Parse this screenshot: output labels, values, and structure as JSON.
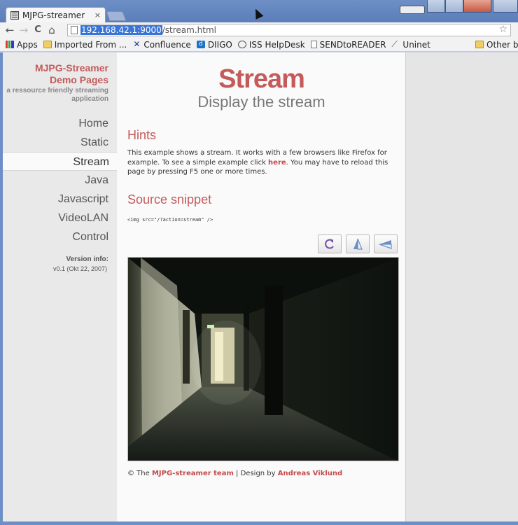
{
  "browser": {
    "tab_title": "MJPG-streamer",
    "tab_close": "×",
    "url_host": "192.168.42.1:9000",
    "url_path": "/stream.html",
    "nav": {
      "back": "←",
      "forward": "→",
      "reload": "C",
      "home": "⌂",
      "star": "☆"
    },
    "bookmarks": [
      {
        "label": "Apps",
        "icon": "apps-icon"
      },
      {
        "label": "Imported From ...",
        "icon": "folder-icon"
      },
      {
        "label": "Confluence",
        "icon": "confluence-icon"
      },
      {
        "label": "DIIGO",
        "icon": "diigo-icon"
      },
      {
        "label": "ISS HelpDesk",
        "icon": "iss-icon"
      },
      {
        "label": "SENDtoREADER",
        "icon": "page-icon"
      },
      {
        "label": "Uninet",
        "icon": "uninet-icon"
      }
    ],
    "other_bookmarks": "Other book"
  },
  "site": {
    "title_line1": "MJPG-Streamer",
    "title_line2": "Demo Pages",
    "subtitle": "a ressource friendly streaming application"
  },
  "menu": [
    {
      "label": "Home",
      "active": false
    },
    {
      "label": "Static",
      "active": false
    },
    {
      "label": "Stream",
      "active": true
    },
    {
      "label": "Java",
      "active": false
    },
    {
      "label": "Javascript",
      "active": false
    },
    {
      "label": "VideoLAN",
      "active": false
    },
    {
      "label": "Control",
      "active": false
    }
  ],
  "version": {
    "label": "Version info:",
    "value": "v0.1 (Okt 22, 2007)"
  },
  "page": {
    "heading": "Stream",
    "subheading": "Display the stream",
    "hints_title": "Hints",
    "hints_text_before": "This example shows a stream. It works with a few browsers like Firefox for example. To see a simple example click ",
    "hints_link": "here",
    "hints_text_after": ". You may have to reload this page by pressing F5 one or more times.",
    "snippet_title": "Source snippet",
    "snippet_code": "<img src=\"/?action=stream\" />",
    "stream_buttons": [
      {
        "name": "rotate-button",
        "icon": "rotate-icon"
      },
      {
        "name": "flip-vertical-button",
        "icon": "flip-vertical-icon"
      },
      {
        "name": "flip-horizontal-button",
        "icon": "flip-horizontal-icon"
      }
    ]
  },
  "footer": {
    "prefix": "© The ",
    "team_link": "MJPG-streamer team",
    "separator": " | Design by ",
    "designer_link": "Andreas Viklund"
  },
  "colors": {
    "accent": "#c45a5a",
    "chrome_frame": "#6e8fc6",
    "sidebar_bg": "#e9e9e9"
  }
}
